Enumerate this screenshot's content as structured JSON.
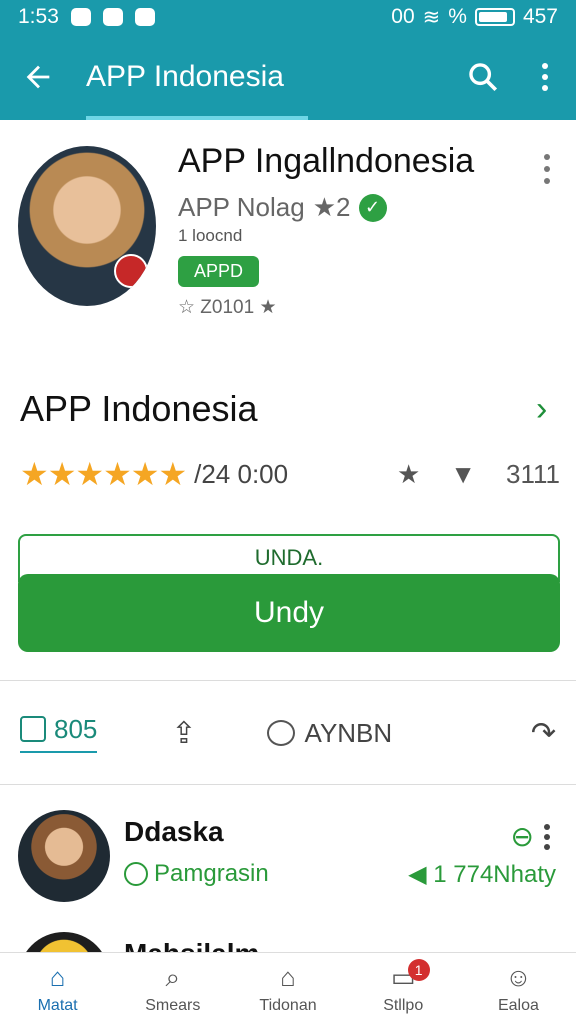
{
  "status_bar": {
    "time": "1:53",
    "battery_text": "457",
    "signal_text": "00",
    "percent": "%"
  },
  "app_bar": {
    "title": "APP Indonesia"
  },
  "profile": {
    "name": "APP Ingallndonesia",
    "subtitle": "APP Nolag",
    "subtitle_suffix": "★2",
    "meta": "1 loocnd",
    "pill": "APPD",
    "rank": "☆ Z0101 ★"
  },
  "app": {
    "title": "APP Indonesia",
    "stars": "★★★★★★",
    "rating_text": "/24 0:00",
    "right_count": "3111"
  },
  "buttons": {
    "outline_label": "UNDA.",
    "fill_label": "Undy"
  },
  "actions": {
    "count": "805",
    "comment_label": "AYNBN"
  },
  "list": [
    {
      "name": "Ddaska",
      "status": "Pamgrasin",
      "right": "1 774Nhaty"
    },
    {
      "name": "Mahsilalm"
    }
  ],
  "bottom_nav": [
    {
      "label": "Matat"
    },
    {
      "label": "Smears"
    },
    {
      "label": "Tidonan"
    },
    {
      "label": "Stllpo",
      "badge": "1"
    },
    {
      "label": "Ealoa"
    }
  ]
}
